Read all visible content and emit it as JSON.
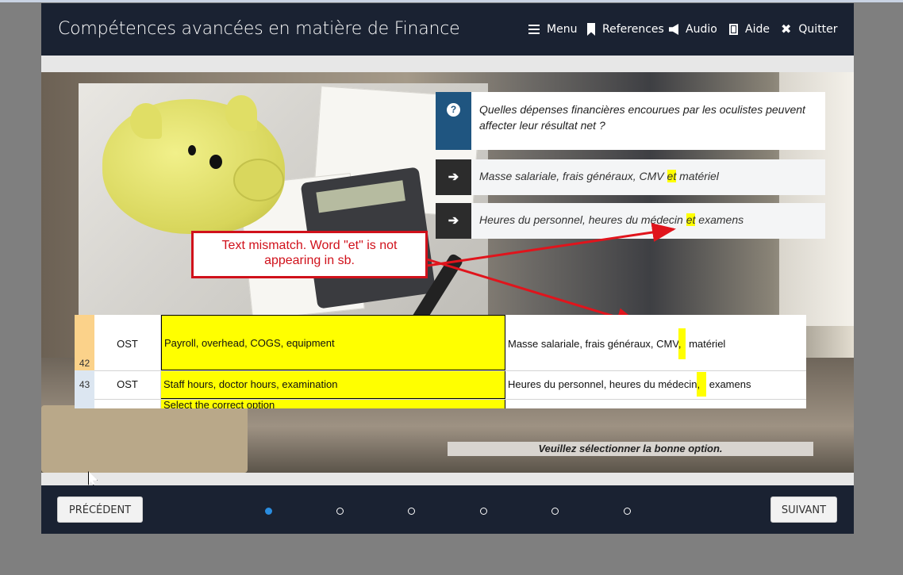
{
  "app": {
    "title": "Compétences avancées en matière de Finance"
  },
  "nav": {
    "menu": "Menu",
    "references": "References",
    "audio": "Audio",
    "help": "Aide",
    "quit": "Quitter"
  },
  "question": {
    "text": "Quelles dépenses financières encourues par les oculistes peuvent affecter leur résultat net ?"
  },
  "options": [
    {
      "before": "Masse salariale, frais généraux, CMV ",
      "highlight": "et",
      "after": " matériel"
    },
    {
      "before": "Heures du personnel, heures du médecin ",
      "highlight": "et",
      "after": " examens"
    }
  ],
  "callout": {
    "text": "Text mismatch. Word \"et\" is not appearing in sb."
  },
  "sheet": {
    "rows": [
      {
        "row": "42",
        "code": "OST",
        "english": "Payroll, overhead, COGS, equipment",
        "french_before": "Masse salariale, frais généraux, CMV",
        "french_highlight": ",",
        "french_after": " matériel"
      },
      {
        "row": "43",
        "code": "OST",
        "english": "Staff hours, doctor hours, examination",
        "french_before": "Heures du personnel, heures du médecin",
        "french_highlight": ",",
        "french_after": " examens"
      }
    ],
    "partial_text": "Select the correct option"
  },
  "status": {
    "text": "Veuillez sélectionner la bonne option."
  },
  "footer": {
    "prev_label": "PRÉCÉDENT",
    "next_label": "SUIVANT",
    "active_dot": 0,
    "dot_count": 6
  },
  "colors": {
    "header": "#1a2232",
    "question_accent": "#1f5580",
    "highlight": "#ffff00",
    "callout": "#d0111b",
    "active_dot": "#2a8de0"
  }
}
